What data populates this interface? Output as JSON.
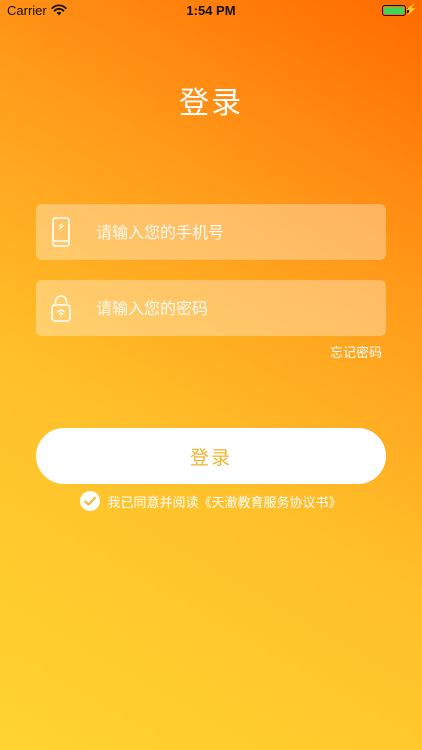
{
  "status_bar": {
    "carrier": "Carrier",
    "time": "1:54 PM",
    "battery_color": "#43d25a"
  },
  "page": {
    "title": "登录"
  },
  "form": {
    "phone_placeholder": "请输入您的手机号",
    "phone_value": "",
    "phone_icon": "mobile-phone-icon",
    "password_placeholder": "请输入您的密码",
    "password_value": "",
    "password_icon": "padlock-icon",
    "forgot_password": "忘记密码",
    "login_button": "登录",
    "agreement_checked": true,
    "agreement_text": "我已同意并阅读《天澈教育服务协议书》"
  },
  "colors": {
    "gradient_top": "#ff6a00",
    "gradient_bottom": "#ffd430",
    "login_button_text": "#f1b32b"
  }
}
